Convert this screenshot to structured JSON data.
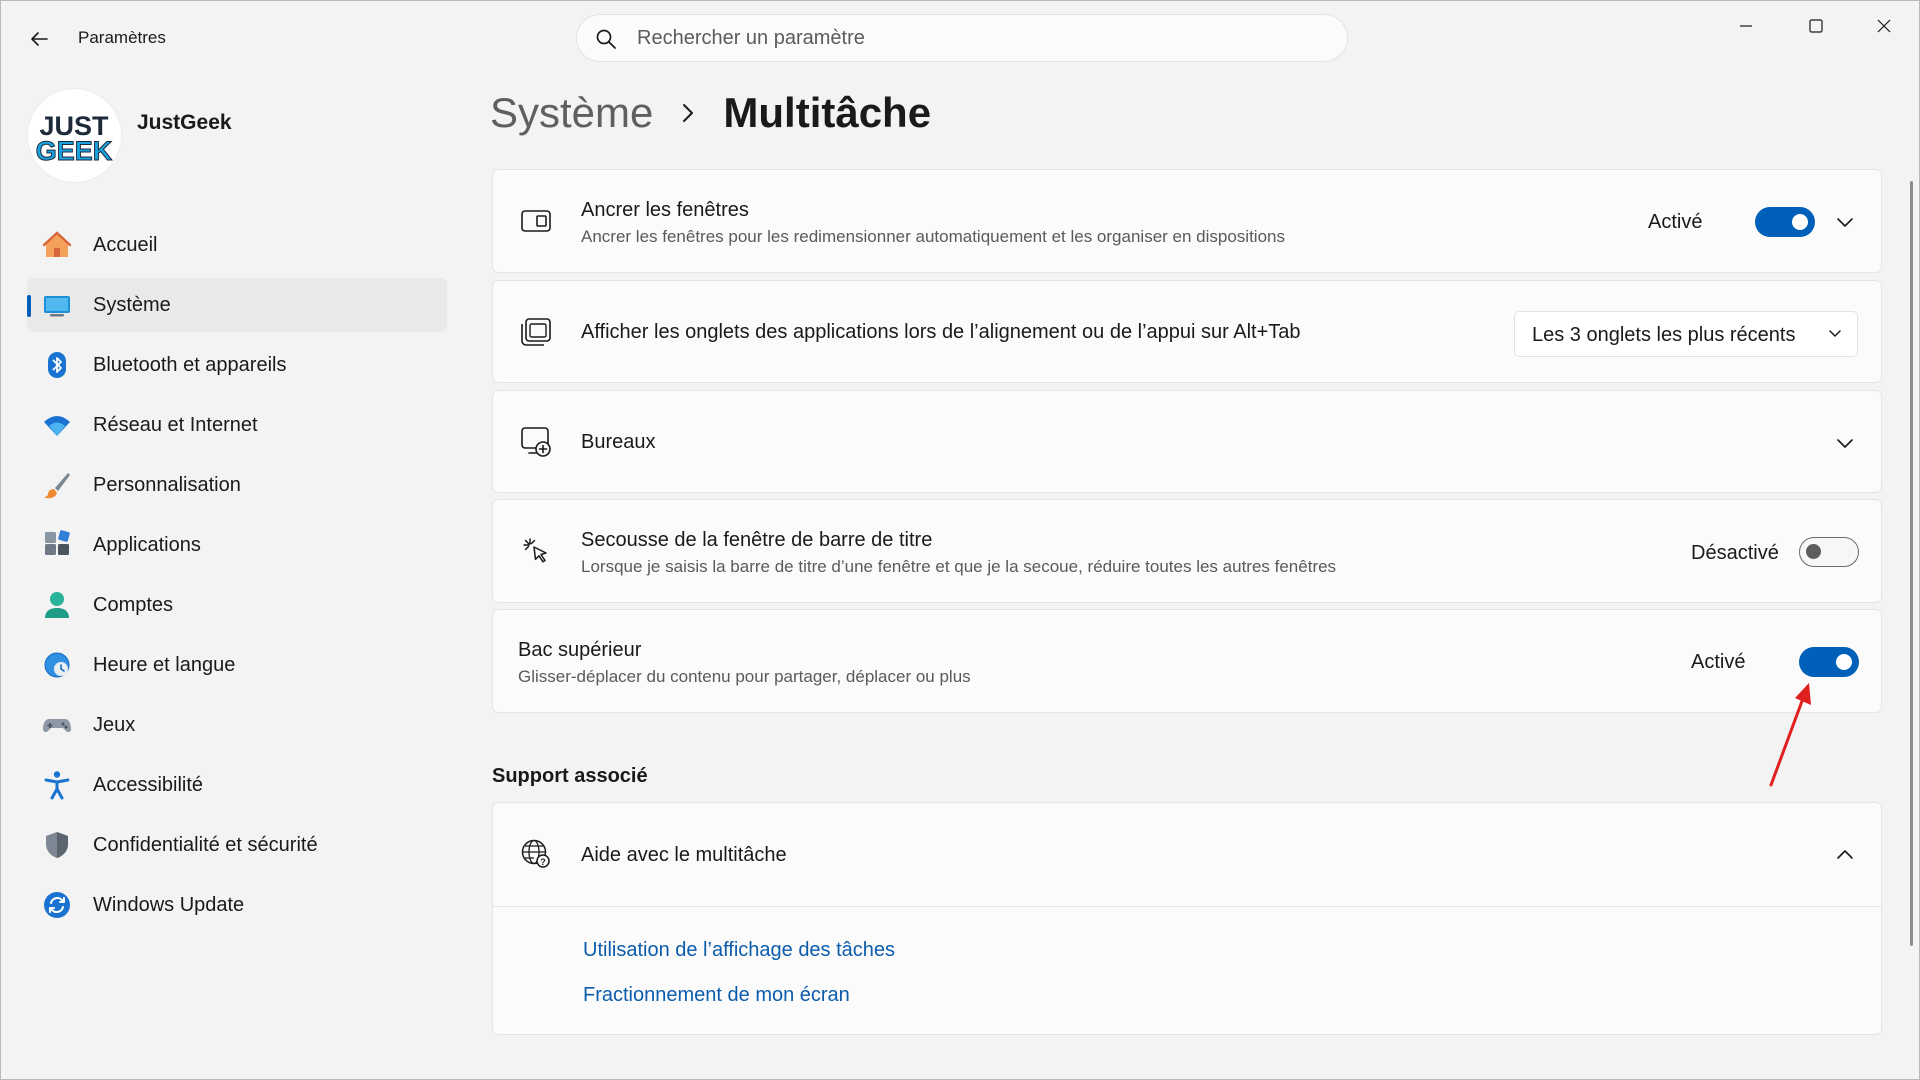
{
  "window": {
    "app_title": "Paramètres",
    "search_placeholder": "Rechercher un paramètre"
  },
  "profile": {
    "name": "JustGeek",
    "logo_text_top": "JUST",
    "logo_text_bottom": "GEEK"
  },
  "sidebar": {
    "items": [
      {
        "label": "Accueil",
        "icon": "home-icon"
      },
      {
        "label": "Système",
        "icon": "system-icon",
        "active": true
      },
      {
        "label": "Bluetooth et appareils",
        "icon": "bluetooth-icon"
      },
      {
        "label": "Réseau et Internet",
        "icon": "wifi-icon"
      },
      {
        "label": "Personnalisation",
        "icon": "brush-icon"
      },
      {
        "label": "Applications",
        "icon": "apps-icon"
      },
      {
        "label": "Comptes",
        "icon": "account-icon"
      },
      {
        "label": "Heure et langue",
        "icon": "time-language-icon"
      },
      {
        "label": "Jeux",
        "icon": "gamepad-icon"
      },
      {
        "label": "Accessibilité",
        "icon": "accessibility-icon"
      },
      {
        "label": "Confidentialité et sécurité",
        "icon": "shield-icon"
      },
      {
        "label": "Windows Update",
        "icon": "update-icon"
      }
    ]
  },
  "breadcrumb": {
    "parent": "Système",
    "current": "Multitâche"
  },
  "settings": {
    "snap": {
      "title": "Ancrer les fenêtres",
      "description": "Ancrer les fenêtres pour les redimensionner automatiquement et les organiser en dispositions",
      "state": "Activé",
      "enabled": true
    },
    "tabs": {
      "title": "Afficher les onglets des applications lors de l’alignement ou de l’appui sur Alt+Tab",
      "selected": "Les 3 onglets les plus récents"
    },
    "desktops": {
      "title": "Bureaux"
    },
    "shake": {
      "title": "Secousse de la fenêtre de barre de titre",
      "description": "Lorsque je saisis la barre de titre d’une fenêtre et que je la secoue, réduire toutes les autres fenêtres",
      "state": "Désactivé",
      "enabled": false
    },
    "top_tray": {
      "title": "Bac supérieur",
      "description": "Glisser-déplacer du contenu pour partager, déplacer ou plus",
      "state": "Activé",
      "enabled": true
    }
  },
  "support": {
    "heading": "Support associé",
    "help_title": "Aide avec le multitâche",
    "links": [
      "Utilisation de l’affichage des tâches",
      "Fractionnement de mon écran"
    ]
  },
  "colors": {
    "accent": "#005fb8",
    "link": "#0b5cab",
    "annotation_arrow": "#e0201e"
  }
}
